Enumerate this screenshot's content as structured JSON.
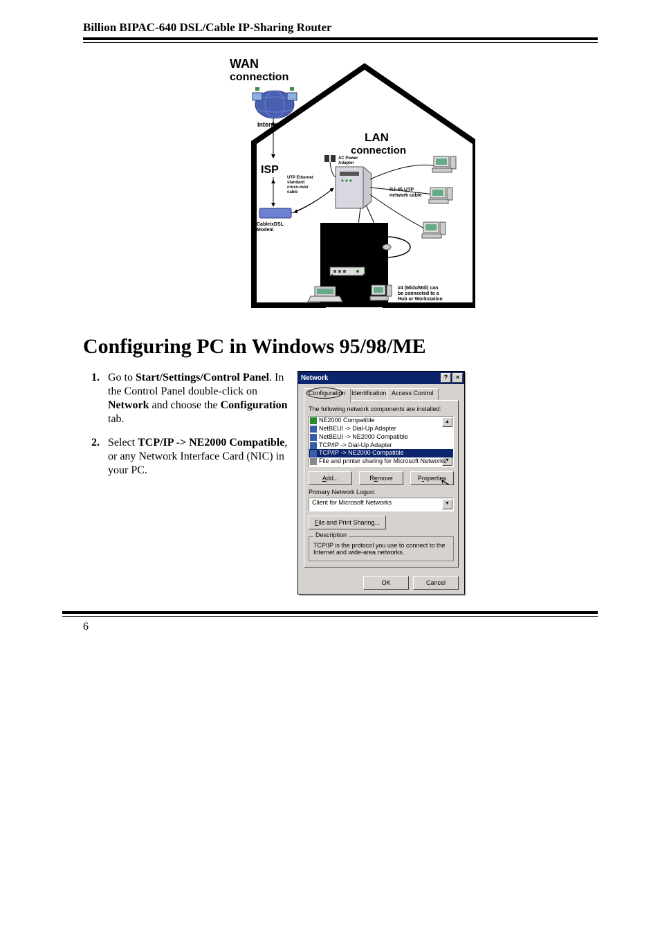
{
  "header": "Billion BIPAC-640 DSL/Cable IP-Sharing Router",
  "page_number": "6",
  "diagram": {
    "wan_title": "WAN connection",
    "lan_title": "LAN connection",
    "internet": "Internet",
    "isp": "ISP",
    "ac_adapter": "AC Power Adapter",
    "utp_cable": "UTP Ethernet standard cross-over cable",
    "modem": "Cable/xDSL Modem",
    "rj45": "RJ-45 UTP network cable",
    "hub": "HUB",
    "hub_note": "#4 (Midx/Mdi) can be connected to a Hub or Workstation"
  },
  "section_title": "Configuring PC in Windows 95/98/ME",
  "steps": [
    {
      "num": "1.",
      "parts": [
        {
          "t": "Go to ",
          "b": false
        },
        {
          "t": "Start/Settings/Control Panel",
          "b": true
        },
        {
          "t": ". In the Control Panel double-click on ",
          "b": false
        },
        {
          "t": "Network",
          "b": true
        },
        {
          "t": " and choose the ",
          "b": false
        },
        {
          "t": "Configuration",
          "b": true
        },
        {
          "t": " tab.",
          "b": false
        }
      ]
    },
    {
      "num": "2.",
      "parts": [
        {
          "t": "Select ",
          "b": false
        },
        {
          "t": "TCP/IP -> NE2000 Compatible",
          "b": true
        },
        {
          "t": ", or any Network Interface Card (NIC) in your PC.",
          "b": false
        }
      ]
    }
  ],
  "dialog": {
    "title": "Network",
    "help_btn": "?",
    "close_btn": "×",
    "tabs": [
      "Configuration",
      "Identification",
      "Access Control"
    ],
    "active_tab": 0,
    "components_label": "The following network components are installed:",
    "list": [
      {
        "text": "NE2000 Compatible",
        "icon": "nic-icon",
        "selected": false
      },
      {
        "text": "NetBEUI -> Dial-Up Adapter",
        "icon": "protocol-icon",
        "selected": false
      },
      {
        "text": "NetBEUI -> NE2000 Compatible",
        "icon": "protocol-icon",
        "selected": false
      },
      {
        "text": "TCP/IP -> Dial-Up Adapter",
        "icon": "protocol-icon",
        "selected": false
      },
      {
        "text": "TCP/IP -> NE2000 Compatible",
        "icon": "protocol-icon",
        "selected": true
      },
      {
        "text": "File and printer sharing for Microsoft Networks",
        "icon": "service-icon",
        "selected": false
      }
    ],
    "btn_add": "Add...",
    "btn_remove": "Remove",
    "btn_properties": "Properties",
    "logon_label": "Primary Network Logon:",
    "logon_value": "Client for Microsoft Networks",
    "btn_fps": "File and Print Sharing...",
    "desc_label": "Description",
    "desc_text": "TCP/IP is the protocol you use to connect to the Internet and wide-area networks.",
    "btn_ok": "OK",
    "btn_cancel": "Cancel"
  }
}
